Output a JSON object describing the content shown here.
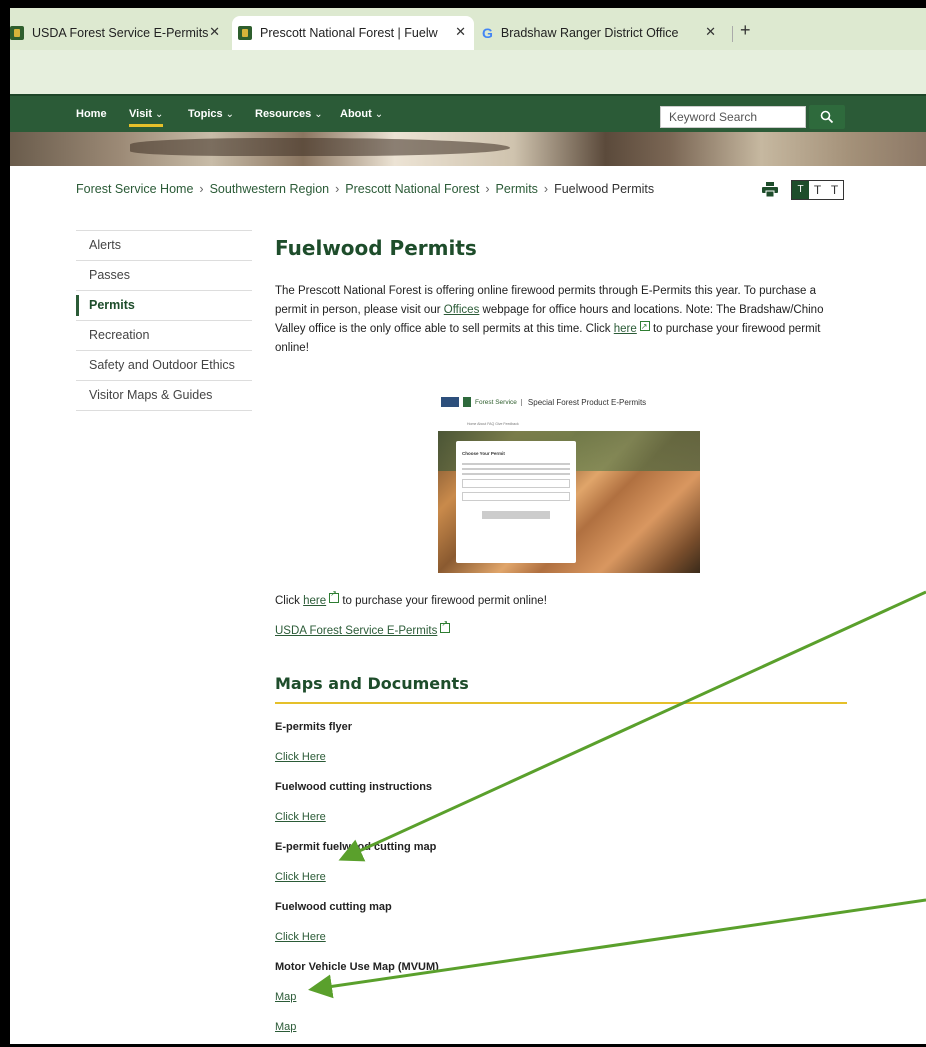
{
  "browser": {
    "tabs": [
      {
        "title": "USDA Forest Service E-Permits",
        "favicon": "forest-service-shield"
      },
      {
        "title": "Prescott National Forest | Fuelw",
        "favicon": "forest-service-shield",
        "active": true
      },
      {
        "title": "Bradshaw Ranger District Office",
        "favicon": "google-g"
      }
    ],
    "new_tab_label": "+",
    "close_glyph": "✕"
  },
  "nav": {
    "items": [
      "Home",
      "Visit",
      "Topics",
      "Resources",
      "About"
    ],
    "active": "Visit",
    "search_placeholder": "Keyword Search"
  },
  "breadcrumb": {
    "items": [
      "Forest Service Home",
      "Southwestern Region",
      "Prescott National Forest",
      "Permits",
      "Fuelwood Permits"
    ],
    "separator": "›"
  },
  "textsize": [
    "T",
    "T",
    "T"
  ],
  "sidebar": {
    "items": [
      "Alerts",
      "Passes",
      "Permits",
      "Recreation",
      "Safety and Outdoor Ethics",
      "Visitor Maps & Guides"
    ],
    "active": "Permits"
  },
  "main": {
    "title": "Fuelwood Permits",
    "intro": {
      "p1": "The Prescott National Forest is offering online firewood permits through E-Permits this year.  To purchase a permit in person, please visit our ",
      "offices_link": "Offices",
      "p2": " webpage for office hours and locations.  Note: The Bradshaw/Chino Valley office is the only office able to sell permits at this time.  Click ",
      "here_link": "here",
      "p3": " to purchase your firewood permit online!"
    },
    "permit_image": {
      "brand": "USDA",
      "fs_label": "Forest Service",
      "title": "Special Forest Product E-Permits",
      "nav": "Home    About    FAQ    Give Feedback",
      "card_title": "Choose Your Permit"
    },
    "click_line": {
      "pre": "Click ",
      "link": "here",
      "post": " to purchase your firewood permit online!"
    },
    "epermits_link": "USDA Forest Service E-Permits",
    "maps_heading": "Maps and Documents",
    "documents": [
      {
        "label": "E-permits flyer",
        "link": "Click Here"
      },
      {
        "label": "Fuelwood cutting instructions",
        "link": "Click Here"
      },
      {
        "label": "E-permit fuelwood cutting map",
        "link": "Click Here"
      },
      {
        "label": "Fuelwood cutting map",
        "link": "Click Here"
      },
      {
        "label": "Motor Vehicle Use Map (MVUM)",
        "link": "Map"
      }
    ],
    "extra_link": "Map"
  },
  "colors": {
    "nav_green": "#2b5b37",
    "accent_yellow": "#e5c02a",
    "annotation_arrow": "#5aa02c"
  }
}
